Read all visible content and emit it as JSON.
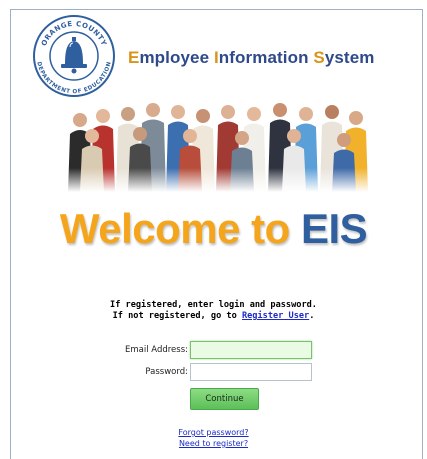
{
  "header": {
    "seal": {
      "top_text": "ORANGE COUNTY",
      "bottom_text": "DEPARTMENT OF EDUCATION"
    },
    "title_parts": [
      {
        "text": "E",
        "cap": true
      },
      {
        "text": "mployee ",
        "cap": false
      },
      {
        "text": "I",
        "cap": true
      },
      {
        "text": "nformation ",
        "cap": false
      },
      {
        "text": "S",
        "cap": true
      },
      {
        "text": "ystem",
        "cap": false
      }
    ]
  },
  "welcome": {
    "part1": "Welcome to ",
    "part2": "EIS"
  },
  "instructions": {
    "line1": "If registered, enter login and password.",
    "line2_prefix": "If not registered, go to ",
    "register_link": "Register User",
    "line2_suffix": "."
  },
  "form": {
    "email_label": "Email Address:",
    "email_value": "",
    "password_label": "Password:",
    "password_value": "",
    "continue_label": "Continue"
  },
  "links": {
    "forgot_password": "Forgot password?",
    "need_to_register": "Need to register?"
  },
  "colors": {
    "title_blue": "#2e4a8a",
    "title_orange": "#d9951a",
    "welcome_orange": "#f4a51c",
    "welcome_blue": "#2f5f9f",
    "link_blue": "#1d2bc6",
    "button_green": "#5cc057"
  }
}
